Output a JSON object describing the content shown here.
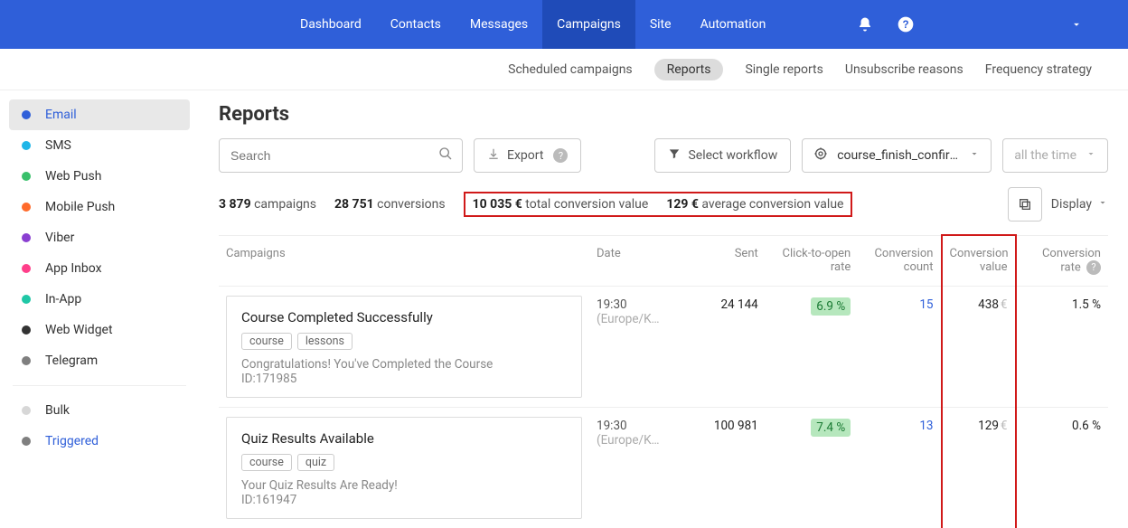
{
  "topnav": {
    "items": [
      "Dashboard",
      "Contacts",
      "Messages",
      "Campaigns",
      "Site",
      "Automation"
    ],
    "active_index": 3
  },
  "subtabs": {
    "items": [
      "Scheduled campaigns",
      "Reports",
      "Single reports",
      "Unsubscribe reasons",
      "Frequency strategy"
    ],
    "active_index": 1
  },
  "sidebar": {
    "channels": [
      {
        "label": "Email",
        "color": "#2f5fd9"
      },
      {
        "label": "SMS",
        "color": "#1fb6e8"
      },
      {
        "label": "Web Push",
        "color": "#39c06b"
      },
      {
        "label": "Mobile Push",
        "color": "#ff6a2b"
      },
      {
        "label": "Viber",
        "color": "#8a3fd1"
      },
      {
        "label": "App Inbox",
        "color": "#ff3f8a"
      },
      {
        "label": "In-App",
        "color": "#1fc7a6"
      },
      {
        "label": "Web Widget",
        "color": "#333333"
      },
      {
        "label": "Telegram",
        "color": "#7f7f7f"
      }
    ],
    "modes": [
      {
        "label": "Bulk",
        "color": "#d7d7d7"
      },
      {
        "label": "Triggered",
        "color": "#7f7f7f"
      }
    ]
  },
  "page_title": "Reports",
  "search": {
    "placeholder": "Search"
  },
  "export_label": "Export",
  "select_workflow_label": "Select workflow",
  "workflow_selected": "course_finish_confirm…",
  "period_label": "all the time",
  "stats": {
    "campaigns_n": "3 879",
    "campaigns_lbl": "campaigns",
    "conversions_n": "28 751",
    "conversions_lbl": "conversions",
    "total_value_n": "10 035 €",
    "total_value_lbl": "total conversion value",
    "avg_value_n": "129 €",
    "avg_value_lbl": "average conversion value"
  },
  "display_label": "Display",
  "columns": {
    "campaign": "Campaigns",
    "date": "Date",
    "sent": "Sent",
    "cto": "Click-to-open rate",
    "conv_count": "Conversion count",
    "conv_value": "Conversion value",
    "conv_rate": "Conversion rate"
  },
  "rows": [
    {
      "title": "Course Completed Successfully",
      "tags": [
        "course",
        "lessons"
      ],
      "subtitle": "Congratulations! You've Completed the Course",
      "id_label": "ID:171985",
      "time": "19:30",
      "tz": "(Europe/K…",
      "sent": "24 144",
      "cto": "6.9 %",
      "conv_count": "15",
      "conv_value": "438",
      "conv_rate": "1.5 %"
    },
    {
      "title": "Quiz Results Available",
      "tags": [
        "course",
        "quiz"
      ],
      "subtitle": "Your Quiz Results Are Ready!",
      "id_label": "ID:161947",
      "time": "19:30",
      "tz": "(Europe/K…",
      "sent": "100 981",
      "cto": "7.4 %",
      "conv_count": "13",
      "conv_value": "129",
      "conv_rate": "0.6 %"
    }
  ],
  "euro": "€"
}
